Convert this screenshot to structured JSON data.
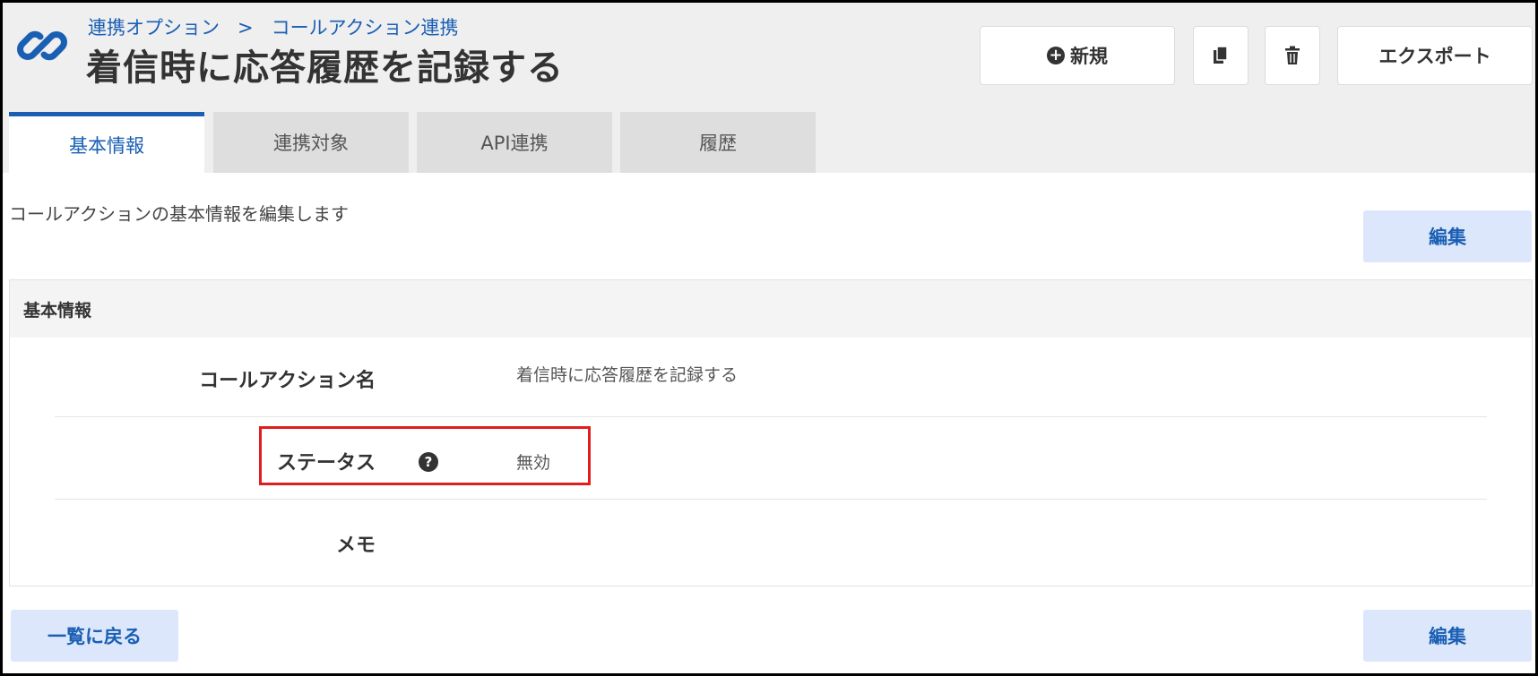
{
  "header": {
    "breadcrumb": [
      "連携オプション",
      ">",
      "コールアクション連携"
    ],
    "title": "着信時に応答履歴を記録する",
    "buttons": {
      "new_label": "新規",
      "export_label": "エクスポート"
    }
  },
  "tabs": [
    {
      "label": "基本情報",
      "active": true
    },
    {
      "label": "連携対象",
      "active": false
    },
    {
      "label": "API連携",
      "active": false
    },
    {
      "label": "履歴",
      "active": false
    }
  ],
  "description": "コールアクションの基本情報を編集します",
  "edit_label": "編集",
  "panel": {
    "heading": "基本情報",
    "rows": [
      {
        "label": "コールアクション名",
        "value": "着信時に応答履歴を記録する"
      },
      {
        "label": "ステータス",
        "value": "無効",
        "help_icon": "?"
      },
      {
        "label": "メモ",
        "value": ""
      }
    ]
  },
  "footer": {
    "back_label": "一覧に戻る",
    "edit_label": "編集"
  },
  "colors": {
    "accent": "#1a5fb4",
    "button_bg": "#dde7fb",
    "header_bg": "#efefef",
    "highlight": "#e01e1e"
  },
  "icons": [
    "link-icon",
    "plus-circle-icon",
    "copy-icon",
    "trash-icon",
    "question-icon"
  ]
}
